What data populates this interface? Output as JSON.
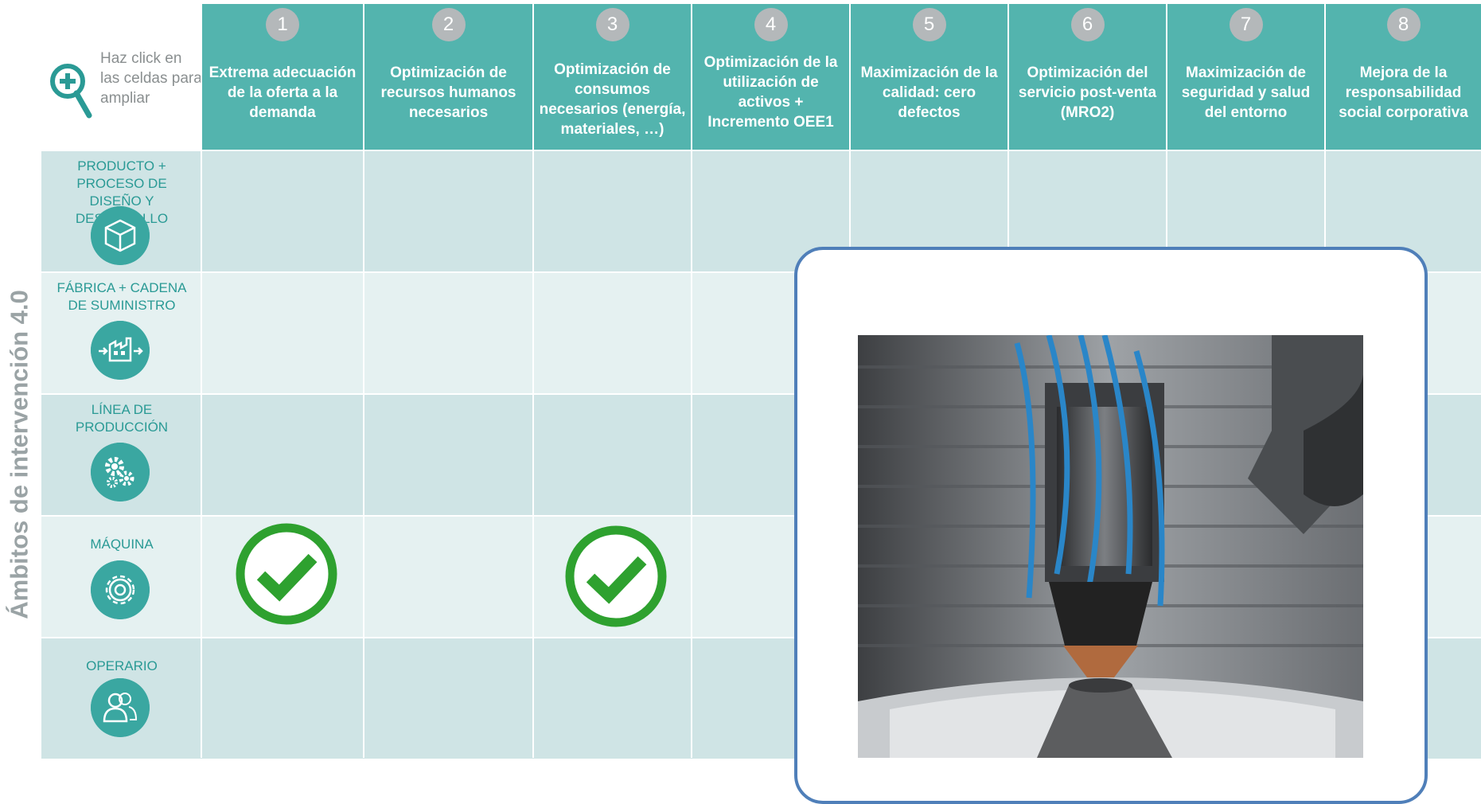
{
  "side_title": "Ámbitos de intervención 4.0",
  "corner": {
    "hint": "Haz click en las celdas para ampliar",
    "icon": "zoom-in-icon"
  },
  "columns": [
    {
      "num": "1",
      "label": "Extrema adecuación de la oferta a la demanda"
    },
    {
      "num": "2",
      "label": "Optimización de recursos humanos necesarios"
    },
    {
      "num": "3",
      "label": "Optimización de consumos necesarios (energía, materiales, …)"
    },
    {
      "num": "4",
      "label": "Optimización de la utilización de activos + Incremento OEE1"
    },
    {
      "num": "5",
      "label": "Maximización de la calidad: cero defectos"
    },
    {
      "num": "6",
      "label": "Optimización del servicio post-venta (MRO2)"
    },
    {
      "num": "7",
      "label": "Maximización de seguridad y salud del entorno"
    },
    {
      "num": "8",
      "label": "Mejora de la responsabilidad social corporativa"
    }
  ],
  "rows": [
    {
      "label": "PRODUCTO + PROCESO DE DISEÑO Y DESARROLLO",
      "icon": "box-icon"
    },
    {
      "label": "FÁBRICA + CADENA DE SUMINISTRO",
      "icon": "factory-icon"
    },
    {
      "label": "LÍNEA DE PRODUCCIÓN",
      "icon": "gears-icon"
    },
    {
      "label": "MÁQUINA",
      "icon": "gear-icon"
    },
    {
      "label": "OPERARIO",
      "icon": "users-icon"
    }
  ],
  "checks": [
    {
      "row": "MÁQUINA",
      "column": "1",
      "icon": "check-circle-icon"
    },
    {
      "row": "MÁQUINA",
      "column": "3",
      "icon": "check-circle-icon"
    }
  ],
  "popup": {
    "image": "3d-metal-printing-nozzle-photo"
  },
  "colors": {
    "header": "#53b4ae",
    "row_dark": "#cfe4e5",
    "row_light": "#e5f1f1",
    "check": "#2ea12f",
    "popup_border": "#4f7fb9",
    "badge": "#b4b8ba"
  }
}
